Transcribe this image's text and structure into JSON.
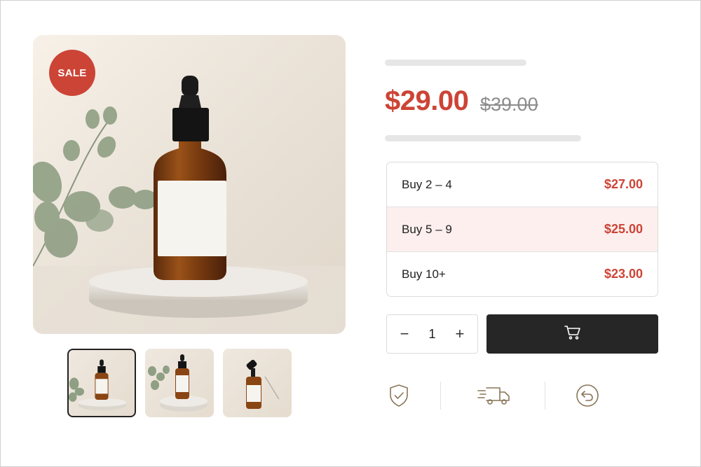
{
  "product": {
    "badge": "SALE",
    "price": "$29.00",
    "old_price": "$39.00",
    "accent_color": "#cc4436"
  },
  "tiers": [
    {
      "label": "Buy 2 – 4",
      "price": "$27.00",
      "highlighted": false
    },
    {
      "label": "Buy 5 – 9",
      "price": "$25.00",
      "highlighted": true
    },
    {
      "label": "Buy 10+",
      "price": "$23.00",
      "highlighted": false
    }
  ],
  "quantity": {
    "minus": "−",
    "value": "1",
    "plus": "+"
  },
  "actions": {
    "cart_icon": "shopping-cart-icon"
  },
  "features": [
    {
      "icon": "shield-check-icon"
    },
    {
      "icon": "delivery-truck-icon"
    },
    {
      "icon": "return-arrow-icon"
    }
  ],
  "thumbnails": [
    {
      "selected": true
    },
    {
      "selected": false
    },
    {
      "selected": false
    }
  ]
}
